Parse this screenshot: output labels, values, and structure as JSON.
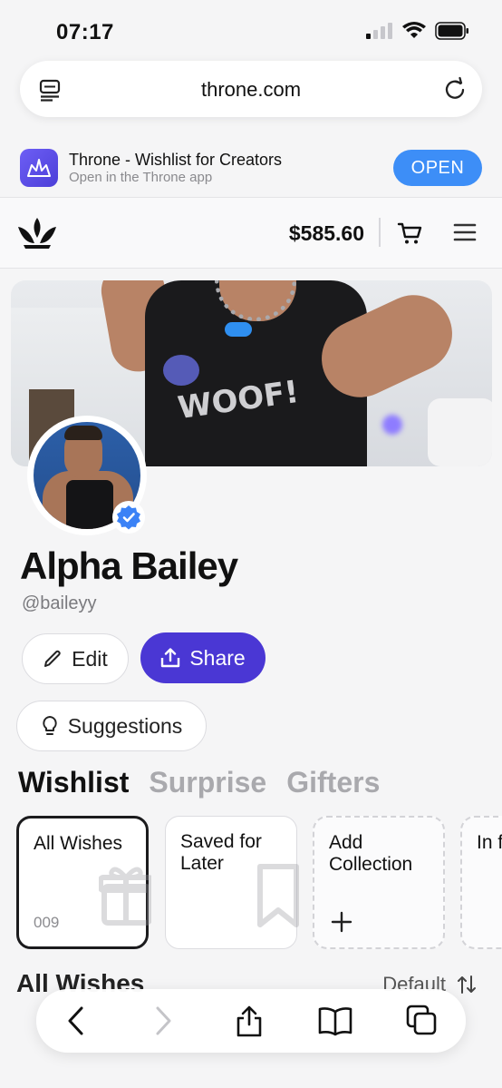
{
  "status": {
    "time": "07:17"
  },
  "browser": {
    "url": "throne.com"
  },
  "banner": {
    "app_title": "Throne - Wishlist for Creators",
    "app_subtitle": "Open in the Throne app",
    "open_label": "OPEN"
  },
  "nav": {
    "balance": "$585.60"
  },
  "profile": {
    "name": "Alpha Bailey",
    "handle": "@baileyy",
    "edit_label": "Edit",
    "share_label": "Share",
    "suggestions_label": "Suggestions"
  },
  "tabs": [
    "Wishlist",
    "Surprise",
    "Gifters"
  ],
  "collections": {
    "all_wishes": {
      "label": "All Wishes",
      "count": "009"
    },
    "saved": {
      "label": "Saved for Later"
    },
    "add": {
      "label": "Add Collection"
    },
    "partial": {
      "label": "In fr A"
    }
  },
  "section": {
    "title": "All Wishes",
    "sort_label": "Default"
  },
  "colors": {
    "accent": "#4a37d4",
    "open_button": "#3d8ef7",
    "verified": "#3b82f6"
  }
}
